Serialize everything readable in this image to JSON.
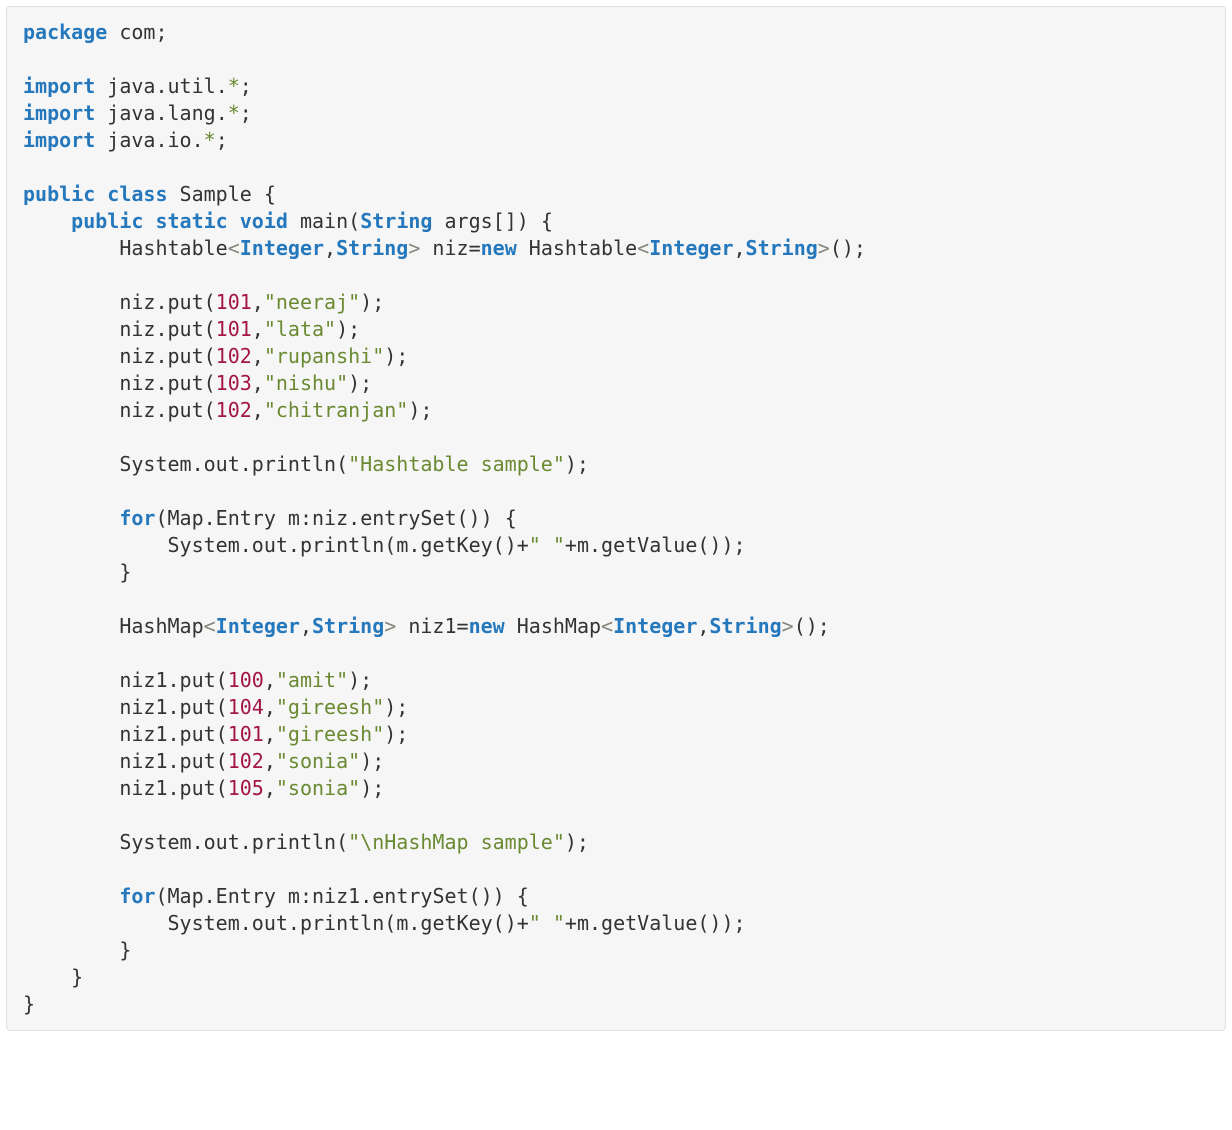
{
  "code": {
    "tokens": [
      [
        [
          "kw",
          "package"
        ],
        [
          "id",
          " com"
        ],
        [
          "op",
          ";"
        ]
      ],
      [],
      [
        [
          "kw",
          "import"
        ],
        [
          "id",
          " java"
        ],
        [
          "op",
          "."
        ],
        [
          "id",
          "util"
        ],
        [
          "op",
          "."
        ],
        [
          "star",
          "*"
        ],
        [
          "op",
          ";"
        ]
      ],
      [
        [
          "kw",
          "import"
        ],
        [
          "id",
          " java"
        ],
        [
          "op",
          "."
        ],
        [
          "id",
          "lang"
        ],
        [
          "op",
          "."
        ],
        [
          "star",
          "*"
        ],
        [
          "op",
          ";"
        ]
      ],
      [
        [
          "kw",
          "import"
        ],
        [
          "id",
          " java"
        ],
        [
          "op",
          "."
        ],
        [
          "id",
          "io"
        ],
        [
          "op",
          "."
        ],
        [
          "star",
          "*"
        ],
        [
          "op",
          ";"
        ]
      ],
      [],
      [
        [
          "kw",
          "public"
        ],
        [
          "id",
          " "
        ],
        [
          "kw",
          "class"
        ],
        [
          "id",
          " Sample "
        ],
        [
          "op",
          "{"
        ]
      ],
      [
        [
          "id",
          "    "
        ],
        [
          "kw",
          "public"
        ],
        [
          "id",
          " "
        ],
        [
          "kw",
          "static"
        ],
        [
          "id",
          " "
        ],
        [
          "kw",
          "void"
        ],
        [
          "id",
          " main"
        ],
        [
          "op",
          "("
        ],
        [
          "type",
          "String"
        ],
        [
          "id",
          " args"
        ],
        [
          "op",
          "[])"
        ],
        [
          "id",
          " "
        ],
        [
          "op",
          "{"
        ]
      ],
      [
        [
          "id",
          "        Hashtable"
        ],
        [
          "ang",
          "<"
        ],
        [
          "type",
          "Integer"
        ],
        [
          "op",
          ","
        ],
        [
          "type",
          "String"
        ],
        [
          "ang",
          ">"
        ],
        [
          "id",
          " niz"
        ],
        [
          "op",
          "="
        ],
        [
          "kw",
          "new"
        ],
        [
          "id",
          " Hashtable"
        ],
        [
          "ang",
          "<"
        ],
        [
          "type",
          "Integer"
        ],
        [
          "op",
          ","
        ],
        [
          "type",
          "String"
        ],
        [
          "ang",
          ">"
        ],
        [
          "op",
          "();"
        ]
      ],
      [],
      [
        [
          "id",
          "        niz"
        ],
        [
          "op",
          "."
        ],
        [
          "id",
          "put"
        ],
        [
          "op",
          "("
        ],
        [
          "num",
          "101"
        ],
        [
          "op",
          ","
        ],
        [
          "str",
          "\"neeraj\""
        ],
        [
          "op",
          ");"
        ]
      ],
      [
        [
          "id",
          "        niz"
        ],
        [
          "op",
          "."
        ],
        [
          "id",
          "put"
        ],
        [
          "op",
          "("
        ],
        [
          "num",
          "101"
        ],
        [
          "op",
          ","
        ],
        [
          "str",
          "\"lata\""
        ],
        [
          "op",
          ");"
        ]
      ],
      [
        [
          "id",
          "        niz"
        ],
        [
          "op",
          "."
        ],
        [
          "id",
          "put"
        ],
        [
          "op",
          "("
        ],
        [
          "num",
          "102"
        ],
        [
          "op",
          ","
        ],
        [
          "str",
          "\"rupanshi\""
        ],
        [
          "op",
          ");"
        ]
      ],
      [
        [
          "id",
          "        niz"
        ],
        [
          "op",
          "."
        ],
        [
          "id",
          "put"
        ],
        [
          "op",
          "("
        ],
        [
          "num",
          "103"
        ],
        [
          "op",
          ","
        ],
        [
          "str",
          "\"nishu\""
        ],
        [
          "op",
          ");"
        ]
      ],
      [
        [
          "id",
          "        niz"
        ],
        [
          "op",
          "."
        ],
        [
          "id",
          "put"
        ],
        [
          "op",
          "("
        ],
        [
          "num",
          "102"
        ],
        [
          "op",
          ","
        ],
        [
          "str",
          "\"chitranjan\""
        ],
        [
          "op",
          ");"
        ]
      ],
      [],
      [
        [
          "id",
          "        System"
        ],
        [
          "op",
          "."
        ],
        [
          "id",
          "out"
        ],
        [
          "op",
          "."
        ],
        [
          "id",
          "println"
        ],
        [
          "op",
          "("
        ],
        [
          "str",
          "\"Hashtable sample\""
        ],
        [
          "op",
          ");"
        ]
      ],
      [],
      [
        [
          "id",
          "        "
        ],
        [
          "kw",
          "for"
        ],
        [
          "op",
          "("
        ],
        [
          "id",
          "Map"
        ],
        [
          "op",
          "."
        ],
        [
          "id",
          "Entry m"
        ],
        [
          "op",
          ":"
        ],
        [
          "id",
          "niz"
        ],
        [
          "op",
          "."
        ],
        [
          "id",
          "entrySet"
        ],
        [
          "op",
          "())"
        ],
        [
          "id",
          " "
        ],
        [
          "op",
          "{"
        ]
      ],
      [
        [
          "id",
          "            System"
        ],
        [
          "op",
          "."
        ],
        [
          "id",
          "out"
        ],
        [
          "op",
          "."
        ],
        [
          "id",
          "println"
        ],
        [
          "op",
          "("
        ],
        [
          "id",
          "m"
        ],
        [
          "op",
          "."
        ],
        [
          "id",
          "getKey"
        ],
        [
          "op",
          "()+"
        ],
        [
          "str",
          "\" \""
        ],
        [
          "op",
          "+"
        ],
        [
          "id",
          "m"
        ],
        [
          "op",
          "."
        ],
        [
          "id",
          "getValue"
        ],
        [
          "op",
          "());"
        ]
      ],
      [
        [
          "id",
          "        "
        ],
        [
          "op",
          "}"
        ]
      ],
      [],
      [
        [
          "id",
          "        HashMap"
        ],
        [
          "ang",
          "<"
        ],
        [
          "type",
          "Integer"
        ],
        [
          "op",
          ","
        ],
        [
          "type",
          "String"
        ],
        [
          "ang",
          ">"
        ],
        [
          "id",
          " niz1"
        ],
        [
          "op",
          "="
        ],
        [
          "kw",
          "new"
        ],
        [
          "id",
          " HashMap"
        ],
        [
          "ang",
          "<"
        ],
        [
          "type",
          "Integer"
        ],
        [
          "op",
          ","
        ],
        [
          "type",
          "String"
        ],
        [
          "ang",
          ">"
        ],
        [
          "op",
          "();"
        ]
      ],
      [],
      [
        [
          "id",
          "        niz1"
        ],
        [
          "op",
          "."
        ],
        [
          "id",
          "put"
        ],
        [
          "op",
          "("
        ],
        [
          "num",
          "100"
        ],
        [
          "op",
          ","
        ],
        [
          "str",
          "\"amit\""
        ],
        [
          "op",
          ");"
        ]
      ],
      [
        [
          "id",
          "        niz1"
        ],
        [
          "op",
          "."
        ],
        [
          "id",
          "put"
        ],
        [
          "op",
          "("
        ],
        [
          "num",
          "104"
        ],
        [
          "op",
          ","
        ],
        [
          "str",
          "\"gireesh\""
        ],
        [
          "op",
          ");"
        ]
      ],
      [
        [
          "id",
          "        niz1"
        ],
        [
          "op",
          "."
        ],
        [
          "id",
          "put"
        ],
        [
          "op",
          "("
        ],
        [
          "num",
          "101"
        ],
        [
          "op",
          ","
        ],
        [
          "str",
          "\"gireesh\""
        ],
        [
          "op",
          ");"
        ]
      ],
      [
        [
          "id",
          "        niz1"
        ],
        [
          "op",
          "."
        ],
        [
          "id",
          "put"
        ],
        [
          "op",
          "("
        ],
        [
          "num",
          "102"
        ],
        [
          "op",
          ","
        ],
        [
          "str",
          "\"sonia\""
        ],
        [
          "op",
          ");"
        ]
      ],
      [
        [
          "id",
          "        niz1"
        ],
        [
          "op",
          "."
        ],
        [
          "id",
          "put"
        ],
        [
          "op",
          "("
        ],
        [
          "num",
          "105"
        ],
        [
          "op",
          ","
        ],
        [
          "str",
          "\"sonia\""
        ],
        [
          "op",
          ");"
        ]
      ],
      [],
      [
        [
          "id",
          "        System"
        ],
        [
          "op",
          "."
        ],
        [
          "id",
          "out"
        ],
        [
          "op",
          "."
        ],
        [
          "id",
          "println"
        ],
        [
          "op",
          "("
        ],
        [
          "str",
          "\"\\nHashMap sample\""
        ],
        [
          "op",
          ");"
        ]
      ],
      [],
      [
        [
          "id",
          "        "
        ],
        [
          "kw",
          "for"
        ],
        [
          "op",
          "("
        ],
        [
          "id",
          "Map"
        ],
        [
          "op",
          "."
        ],
        [
          "id",
          "Entry m"
        ],
        [
          "op",
          ":"
        ],
        [
          "id",
          "niz1"
        ],
        [
          "op",
          "."
        ],
        [
          "id",
          "entrySet"
        ],
        [
          "op",
          "())"
        ],
        [
          "id",
          " "
        ],
        [
          "op",
          "{"
        ]
      ],
      [
        [
          "id",
          "            System"
        ],
        [
          "op",
          "."
        ],
        [
          "id",
          "out"
        ],
        [
          "op",
          "."
        ],
        [
          "id",
          "println"
        ],
        [
          "op",
          "("
        ],
        [
          "id",
          "m"
        ],
        [
          "op",
          "."
        ],
        [
          "id",
          "getKey"
        ],
        [
          "op",
          "()+"
        ],
        [
          "str",
          "\" \""
        ],
        [
          "op",
          "+"
        ],
        [
          "id",
          "m"
        ],
        [
          "op",
          "."
        ],
        [
          "id",
          "getValue"
        ],
        [
          "op",
          "());"
        ]
      ],
      [
        [
          "id",
          "        "
        ],
        [
          "op",
          "}"
        ]
      ],
      [
        [
          "id",
          "    "
        ],
        [
          "op",
          "}"
        ]
      ],
      [
        [
          "op",
          "}"
        ]
      ]
    ]
  }
}
